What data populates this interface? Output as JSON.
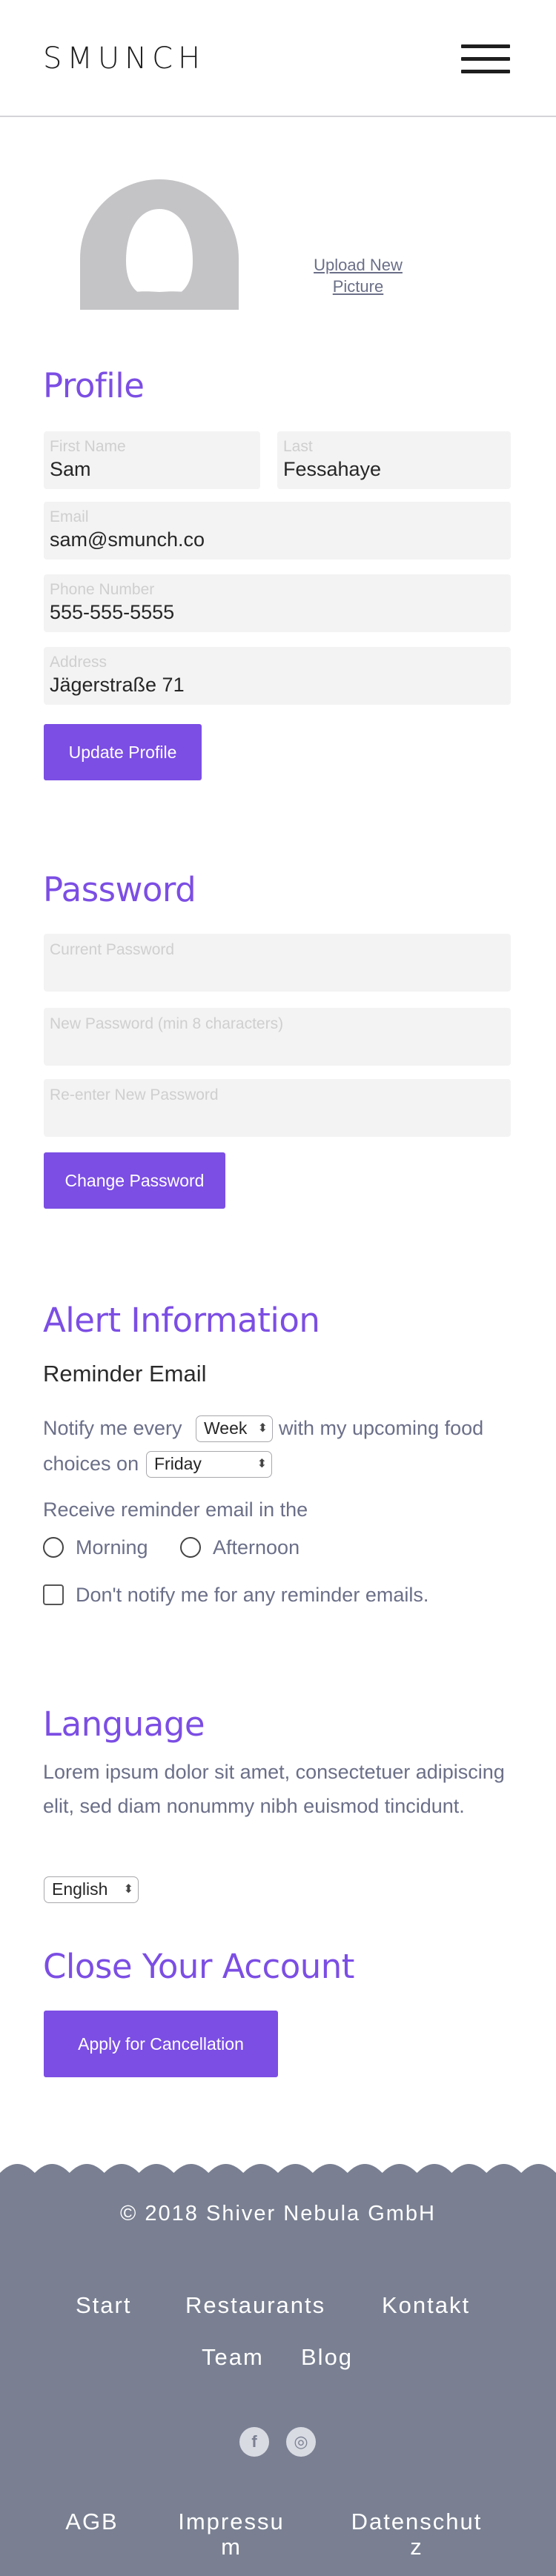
{
  "header": {
    "logo": "SMUNCH"
  },
  "avatar": {
    "upload_label": "Upload New Picture"
  },
  "profile": {
    "title": "Profile",
    "first_name": {
      "label": "First Name",
      "value": "Sam"
    },
    "last_name": {
      "label": "Last",
      "value": "Fessahaye"
    },
    "email": {
      "label": "Email",
      "value": "sam@smunch.co"
    },
    "phone": {
      "label": "Phone Number",
      "value": "555-555-5555"
    },
    "address": {
      "label": "Address",
      "value": "Jägerstraße 71"
    },
    "button": "Update Profile"
  },
  "password": {
    "title": "Password",
    "current": "Current Password",
    "new": "New Password (min 8 characters)",
    "reenter": "Re-enter New Password",
    "button": "Change Password"
  },
  "alerts": {
    "title": "Alert Information",
    "subtitle": "Reminder Email",
    "notify_prefix": "Notify me every",
    "frequency": "Week",
    "notify_suffix": "with my upcoming food",
    "choices_on": "choices on",
    "day": "Friday",
    "receive_label": "Receive reminder email in the",
    "morning": "Morning",
    "afternoon": "Afternoon",
    "dont_notify": "Don't notify me for any reminder emails."
  },
  "language": {
    "title": "Language",
    "description": "Lorem ipsum dolor sit amet, consectetuer adipiscing elit, sed diam nonummy nibh euismod tincidunt.",
    "selected": "English"
  },
  "close_account": {
    "title": "Close Your Account",
    "button": "Apply for Cancellation"
  },
  "footer": {
    "copyright": "© 2018 Shiver Nebula GmbH",
    "nav": {
      "start": "Start",
      "restaurants": "Restaurants",
      "kontakt": "Kontakt",
      "team": "Team",
      "blog": "Blog"
    },
    "social": {
      "facebook": "f",
      "instagram": "◎"
    },
    "legal": {
      "agb": "AGB",
      "impressum_1": "Impressu",
      "impressum_2": "m",
      "datenschutz_1": "Datenschut",
      "datenschutz_2": "z"
    }
  },
  "colors": {
    "accent": "#7c4ee4",
    "footer_bg": "#7a8092",
    "field_bg": "#f3f3f3",
    "muted_text": "#6b6f88"
  }
}
